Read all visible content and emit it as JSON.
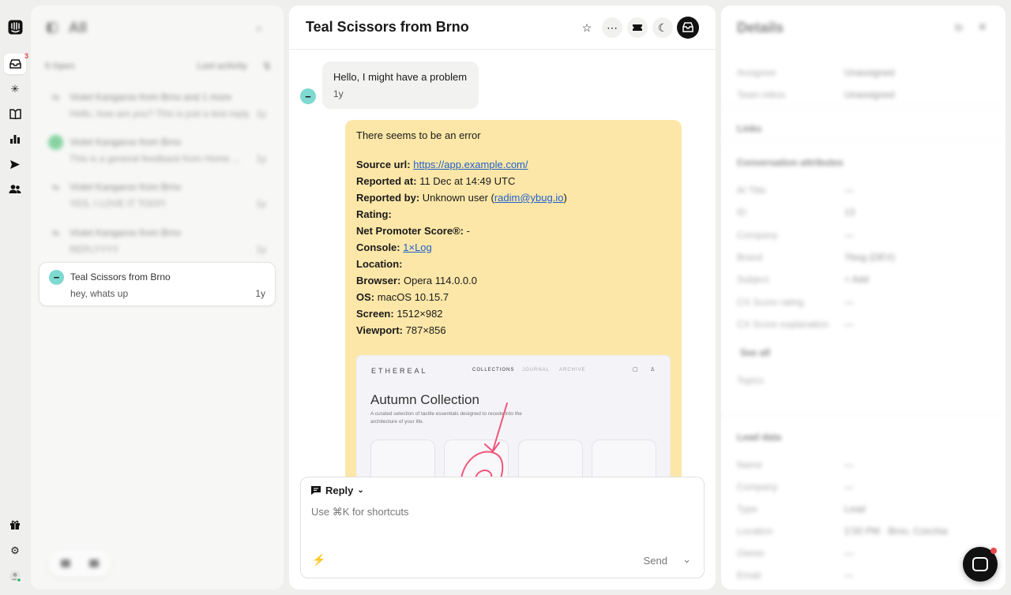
{
  "rail": {
    "inbox_badge": "3"
  },
  "inbox": {
    "title": "All",
    "open_count": "5 Open",
    "sort": "Last activity",
    "conversations": [
      {
        "name": "Violet Kangaroo from Brno and 1 more",
        "preview": "Hello, how are you? This is just a test reply",
        "time": "1y"
      },
      {
        "name": "Violet Kangaroo from Brno",
        "preview": "This is a general feedback from Home ...",
        "time": "1y"
      },
      {
        "name": "Violet Kangaroo from Brno",
        "preview": "YES, I LOVE IT TOO!!!",
        "time": "1y"
      },
      {
        "name": "Violet Kangaroo from Brno",
        "preview": "REPLYYYY",
        "time": "1y"
      },
      {
        "name": "Teal Scissors from Brno",
        "preview": "hey, whats up",
        "time": "1y"
      }
    ]
  },
  "conversation": {
    "title": "Teal Scissors from Brno",
    "message1": {
      "text": "Hello, I might have a problem",
      "time": "1y"
    },
    "message2": {
      "intro": "There seems to be an error",
      "source_url_label": "Source url:",
      "source_url": "https://app.example.com/",
      "reported_at_label": "Reported at:",
      "reported_at": "11 Dec at 14:49 UTC",
      "reported_by_label": "Reported by:",
      "reported_by_prefix": "Unknown user (",
      "reported_by_email": "radim@ybug.io",
      "reported_by_suffix": ")",
      "rating_label": "Rating:",
      "nps_label": "Net Promoter Score®:",
      "nps_value": "-",
      "console_label": "Console:",
      "console_value": "1×Log",
      "location_label": "Location:",
      "browser_label": "Browser:",
      "browser_value": "Opera 114.0.0.0",
      "os_label": "OS:",
      "os_value": "macOS 10.15.7",
      "screen_label": "Screen:",
      "screen_value": "1512×982",
      "viewport_label": "Viewport:",
      "viewport_value": "787×856"
    },
    "screenshot": {
      "brand": "ETHEREAL",
      "nav": [
        "COLLECTIONS",
        "JOURNAL",
        "ARCHIVE"
      ],
      "heading": "Autumn Collection",
      "description": "A curated selection of tactile essentials designed to recede into the architecture of your life.",
      "accent_color": "#f0567a"
    },
    "composer": {
      "mode": "Reply",
      "placeholder": "Use ⌘K for shortcuts",
      "send": "Send"
    }
  },
  "details": {
    "title": "Details",
    "assignee_label": "Assignee",
    "assignee_value": "Unassigned",
    "team_label": "Team inbox",
    "team_value": "Unassigned",
    "links_label": "Links",
    "attributes_label": "Conversation attributes",
    "attributes": [
      {
        "label": "AI Title",
        "value": "—"
      },
      {
        "label": "ID",
        "value": "13"
      },
      {
        "label": "Company",
        "value": "—"
      },
      {
        "label": "Brand",
        "value": "Ybug (DEV)"
      },
      {
        "label": "Subject",
        "value": "+ Add"
      },
      {
        "label": "CX Score rating",
        "value": "—"
      },
      {
        "label": "CX Score explanation",
        "value": "—"
      }
    ],
    "see_all": "See all",
    "topics_label": "Topics",
    "lead_label": "Lead data",
    "lead": [
      {
        "label": "Name",
        "value": "—"
      },
      {
        "label": "Company",
        "value": "—"
      },
      {
        "label": "Type",
        "value": "Lead"
      },
      {
        "label": "Location",
        "value": "2:50 PM · Brno, Czechia"
      },
      {
        "label": "Owner",
        "value": "—"
      },
      {
        "label": "Email",
        "value": "—"
      }
    ]
  }
}
